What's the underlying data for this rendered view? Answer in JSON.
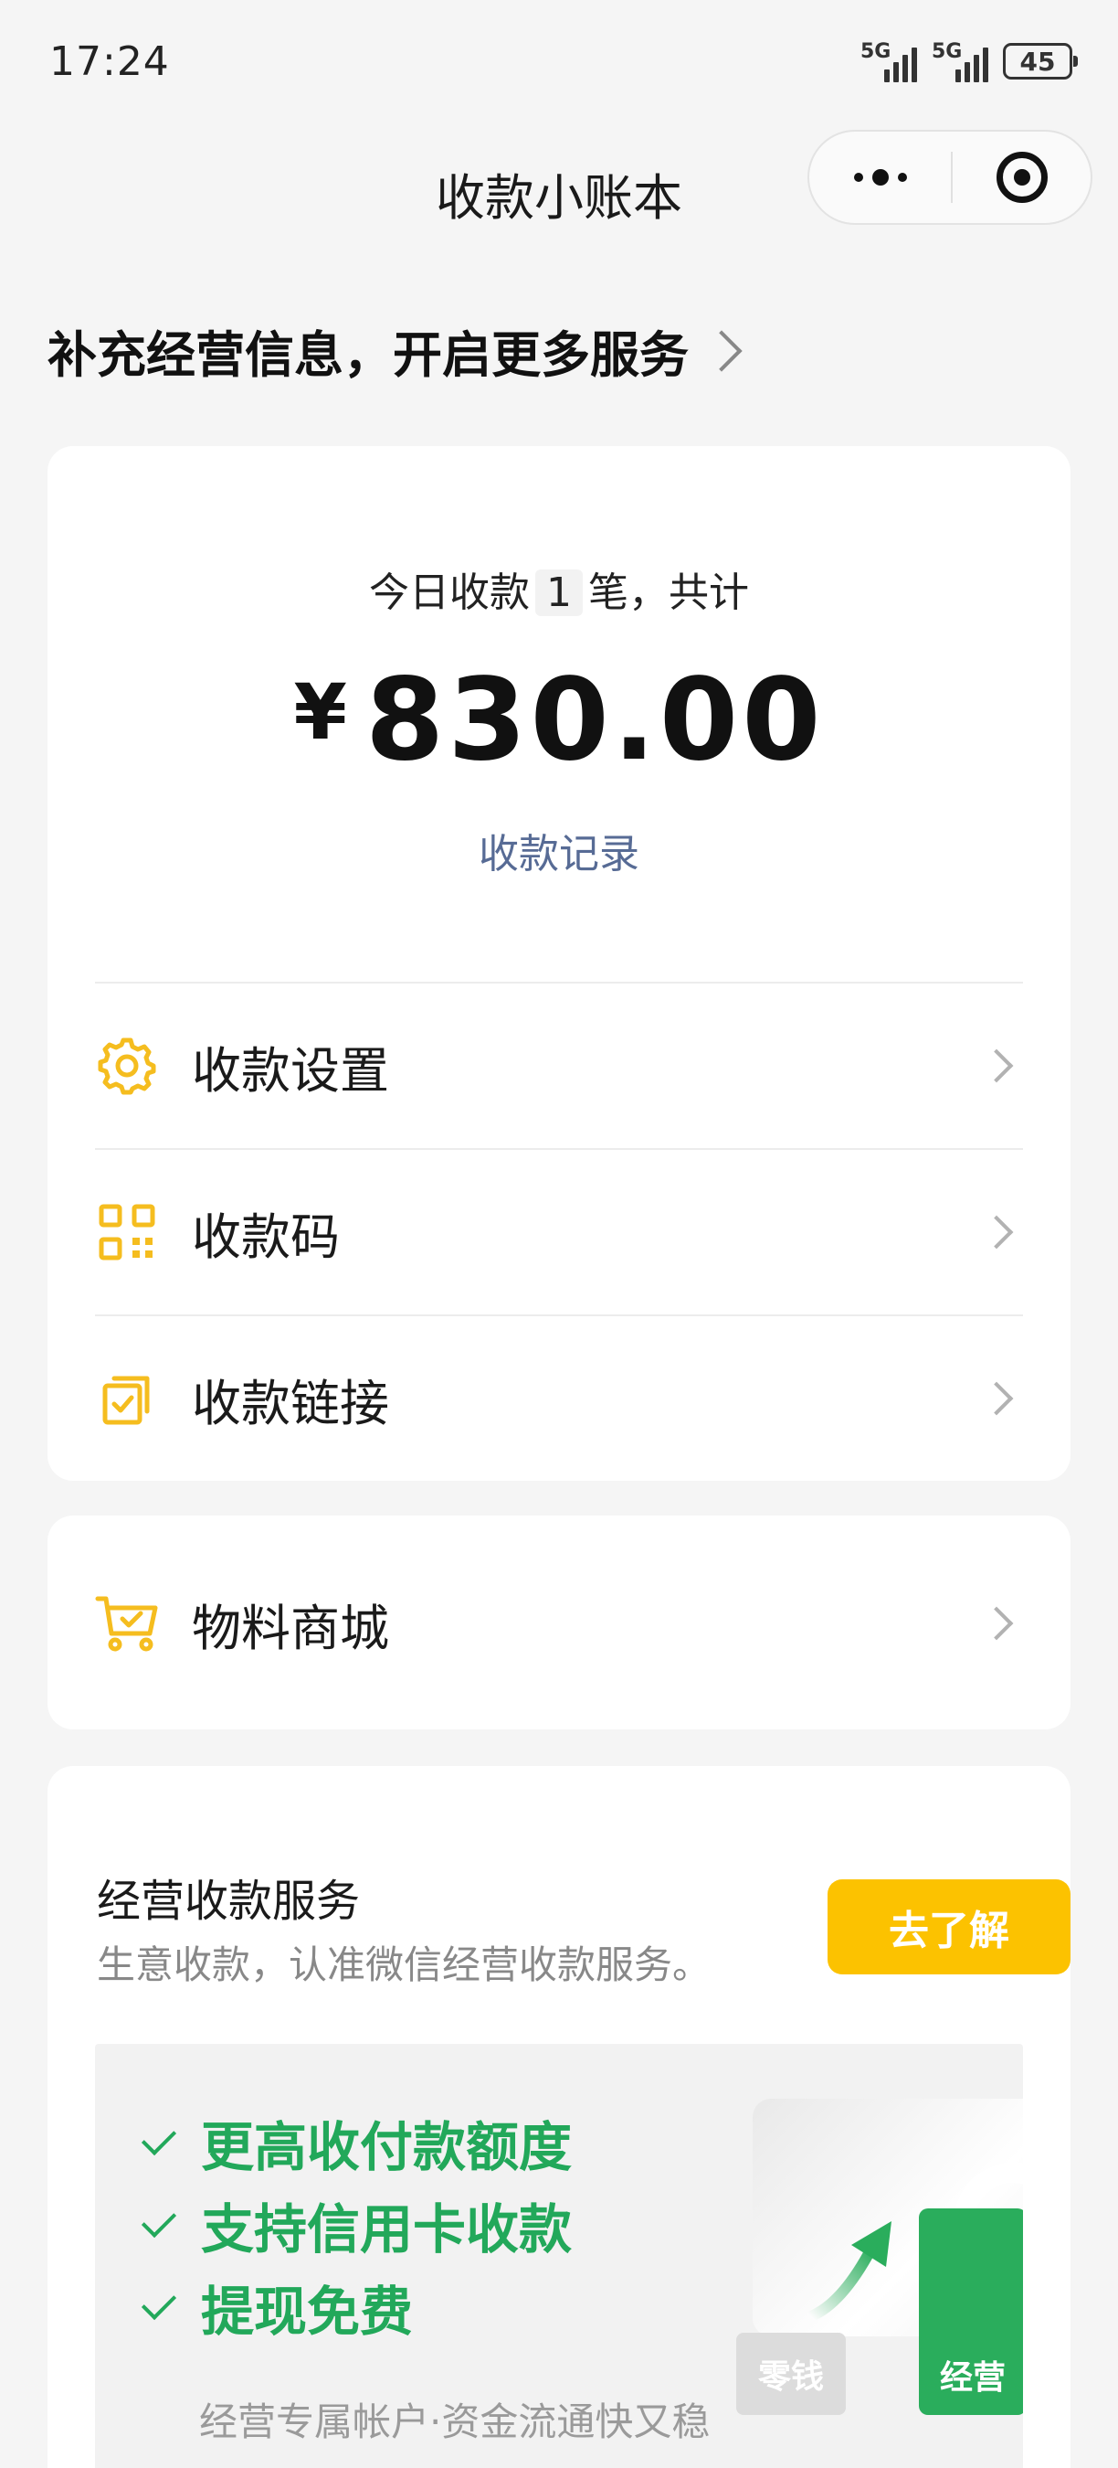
{
  "status_bar": {
    "time": "17:24",
    "network1": "5G",
    "network2": "5G",
    "battery": "45"
  },
  "nav": {
    "title": "收款小账本"
  },
  "promo": {
    "text": "补充经营信息，开启更多服务"
  },
  "summary": {
    "prefix": "今日收款",
    "count": "1",
    "suffix": "笔，共计",
    "currency": "¥",
    "amount": "830.00",
    "records_link": "收款记录"
  },
  "menu": {
    "settings": "收款设置",
    "qr_code": "收款码",
    "link": "收款链接",
    "shop": "物料商城"
  },
  "service": {
    "title": "经营收款服务",
    "subtitle": "生意收款，认准微信经营收款服务。",
    "button": "去了解",
    "features": [
      "更高收付款额度",
      "支持信用卡收款",
      "提现免费"
    ],
    "footer": "经营专属帐户·资金流通快又稳",
    "card_small": "零钱",
    "card_big": "经营"
  },
  "colors": {
    "accent_yellow": "#fcc200",
    "green": "#22a85a",
    "link_blue": "#576b95"
  }
}
